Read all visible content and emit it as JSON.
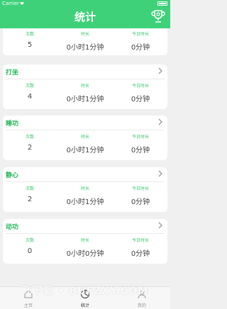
{
  "status_bar": {
    "carrier": "Carrier",
    "time": ""
  },
  "header": {
    "title": "统计"
  },
  "stat_labels": {
    "count": "次数",
    "duration": "时长",
    "today": "今日时长"
  },
  "cards": [
    {
      "title": "",
      "count": "5",
      "duration": "0小时1分钟",
      "today": "0分钟"
    },
    {
      "title": "打坐",
      "count": "4",
      "duration": "0小时1分钟",
      "today": "0分钟"
    },
    {
      "title": "睡功",
      "count": "2",
      "duration": "0小时1分钟",
      "today": "0分钟"
    },
    {
      "title": "静心",
      "count": "2",
      "duration": "0小时1分钟",
      "today": "0分钟"
    },
    {
      "title": "动功",
      "count": "0",
      "duration": "0小时0分钟",
      "today": "0分钟"
    }
  ],
  "tabbar": {
    "tabs": [
      {
        "label": "主页",
        "icon": "home-icon"
      },
      {
        "label": "统计",
        "icon": "stats-icon",
        "active": true
      },
      {
        "label": "我的",
        "icon": "profile-icon"
      }
    ]
  },
  "watermark": "飞下载 • BUFZXY.COM",
  "colors": {
    "header": "#3fd17a",
    "accent": "#2bb85e",
    "label": "#3cc46f",
    "background": "#f0f0f0"
  }
}
